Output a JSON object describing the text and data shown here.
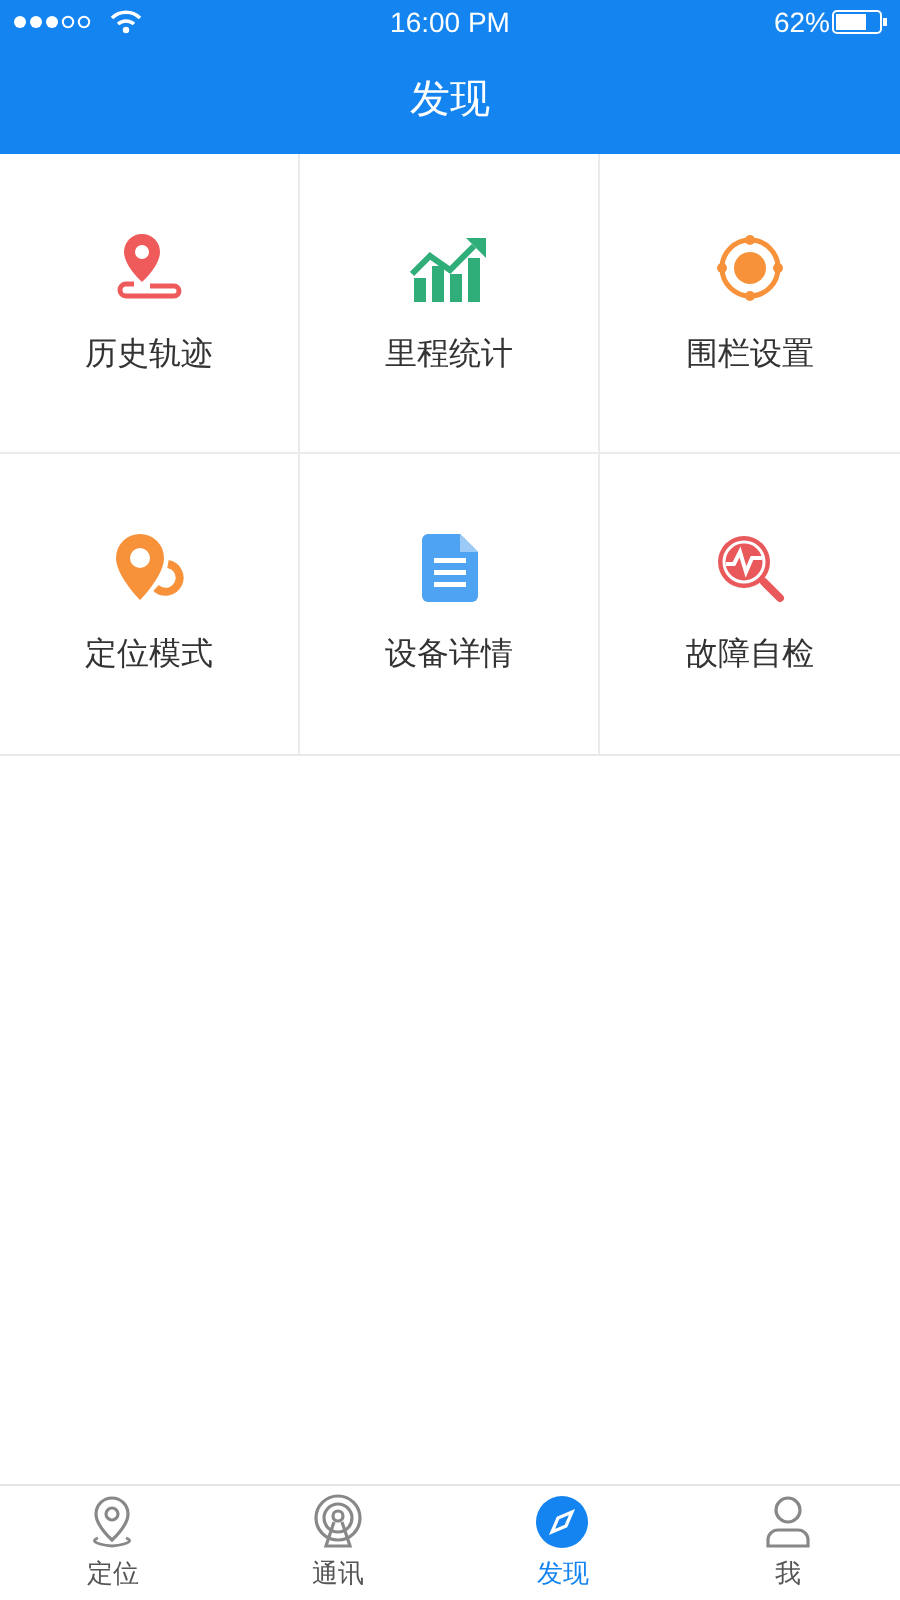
{
  "status_bar": {
    "time": "16:00  PM",
    "battery": "62%"
  },
  "nav": {
    "title": "发现"
  },
  "grid": [
    {
      "label": "历史轨迹",
      "kind": "track"
    },
    {
      "label": "里程统计",
      "kind": "stats"
    },
    {
      "label": "围栏设置",
      "kind": "fence"
    },
    {
      "label": "定位模式",
      "kind": "mode"
    },
    {
      "label": "设备详情",
      "kind": "doc"
    },
    {
      "label": "故障自检",
      "kind": "check"
    }
  ],
  "tabs": [
    {
      "label": "定位",
      "kind": "locate",
      "selected": false
    },
    {
      "label": "通讯",
      "kind": "comm",
      "selected": false
    },
    {
      "label": "发现",
      "kind": "discover",
      "selected": true
    },
    {
      "label": "我",
      "kind": "me",
      "selected": false
    }
  ]
}
